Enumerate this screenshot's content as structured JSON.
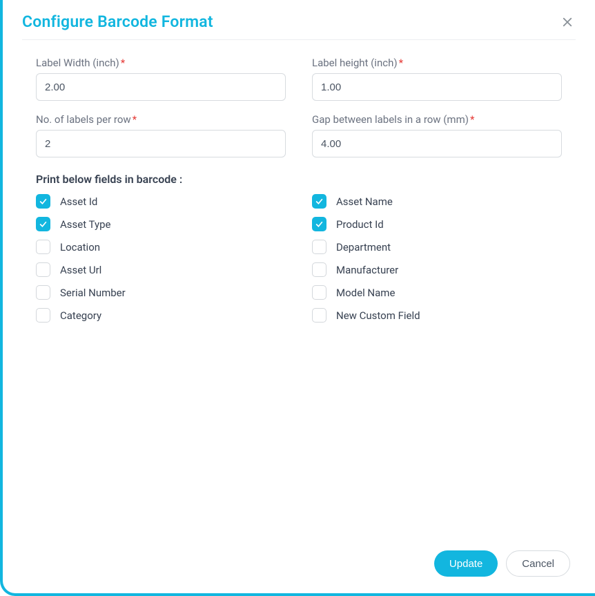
{
  "header": {
    "title": "Configure Barcode Format"
  },
  "form": {
    "label_width": {
      "label": "Label Width (inch)",
      "value": "2.00"
    },
    "label_height": {
      "label": "Label height (inch)",
      "value": "1.00"
    },
    "labels_per_row": {
      "label": "No. of labels per row",
      "value": "2"
    },
    "gap": {
      "label": "Gap between labels in a row (mm)",
      "value": "4.00"
    },
    "required_mark": "*"
  },
  "section_label": "Print below fields in barcode :",
  "checks": {
    "asset_id": {
      "label": "Asset Id",
      "checked": true
    },
    "asset_name": {
      "label": "Asset Name",
      "checked": true
    },
    "asset_type": {
      "label": "Asset Type",
      "checked": true
    },
    "product_id": {
      "label": "Product Id",
      "checked": true
    },
    "location": {
      "label": "Location",
      "checked": false
    },
    "department": {
      "label": "Department",
      "checked": false
    },
    "asset_url": {
      "label": "Asset Url",
      "checked": false
    },
    "manufacturer": {
      "label": "Manufacturer",
      "checked": false
    },
    "serial_number": {
      "label": "Serial Number",
      "checked": false
    },
    "model_name": {
      "label": "Model Name",
      "checked": false
    },
    "category": {
      "label": "Category",
      "checked": false
    },
    "new_custom": {
      "label": "New Custom Field",
      "checked": false
    }
  },
  "footer": {
    "update_label": "Update",
    "cancel_label": "Cancel"
  }
}
